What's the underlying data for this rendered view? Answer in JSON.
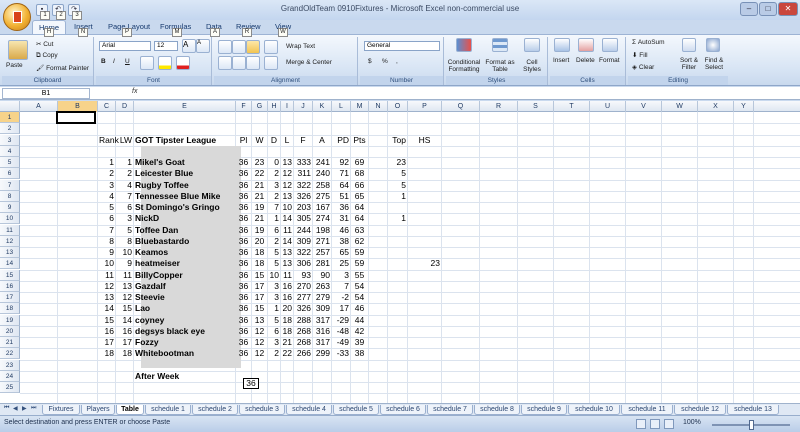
{
  "window": {
    "title": "GrandOldTeam 0910Fixtures - Microsoft Excel non-commercial use"
  },
  "qat": {
    "keytip1": "1",
    "keytip2": "2",
    "keytip3": "3"
  },
  "ribbon": {
    "tabs": [
      {
        "label": "Home",
        "key": "H"
      },
      {
        "label": "Insert",
        "key": "N"
      },
      {
        "label": "Page Layout",
        "key": "P"
      },
      {
        "label": "Formulas",
        "key": "M"
      },
      {
        "label": "Data",
        "key": "A"
      },
      {
        "label": "Review",
        "key": "R"
      },
      {
        "label": "View",
        "key": "W"
      }
    ],
    "clipboard": {
      "paste": "Paste",
      "cut": "Cut",
      "copy": "Copy",
      "format_painter": "Format Painter",
      "label": "Clipboard"
    },
    "font": {
      "name": "Arial",
      "size": "12",
      "bold": "B",
      "italic": "I",
      "underline": "U",
      "label": "Font",
      "grow": "A",
      "shrink": "A"
    },
    "alignment": {
      "wrap": "Wrap Text",
      "merge": "Merge & Center",
      "label": "Alignment"
    },
    "number": {
      "format": "General",
      "currency": "$",
      "percent": "%",
      "comma": ",",
      "label": "Number"
    },
    "styles": {
      "conditional": "Conditional Formatting",
      "format_table": "Format as Table",
      "cell_styles": "Cell Styles",
      "label": "Styles"
    },
    "cells": {
      "insert": "Insert",
      "delete": "Delete",
      "format": "Format",
      "label": "Cells"
    },
    "editing": {
      "autosum": "AutoSum",
      "fill": "Fill",
      "clear": "Clear",
      "sort": "Sort & Filter",
      "find": "Find & Select",
      "label": "Editing"
    }
  },
  "formula_bar": {
    "name_box": "B1",
    "fx": "fx",
    "value": ""
  },
  "columns": [
    "A",
    "B",
    "C",
    "D",
    "E",
    "F",
    "G",
    "H",
    "I",
    "J",
    "K",
    "L",
    "M",
    "N",
    "O",
    "P",
    "Q",
    "R",
    "S",
    "T",
    "U",
    "V",
    "W",
    "X",
    "Y"
  ],
  "rows": [
    "1",
    "2",
    "3",
    "4",
    "5",
    "6",
    "7",
    "8",
    "9",
    "10",
    "11",
    "12",
    "13",
    "14",
    "15",
    "16",
    "17",
    "18",
    "19",
    "20",
    "21",
    "22",
    "23",
    "24",
    "25"
  ],
  "table": {
    "headers": {
      "rank": "Rank",
      "lw": "LW",
      "title": "GOT Tipster League",
      "pl": "Pl",
      "w": "W",
      "d": "D",
      "l": "L",
      "f": "F",
      "a": "A",
      "pd": "PD",
      "pts": "Pts",
      "top": "Top",
      "hs": "HS"
    },
    "rows": [
      {
        "rank": "1",
        "lw": "1",
        "name": "Mikel's Goat",
        "pl": "36",
        "w": "23",
        "d": "0",
        "l": "13",
        "f": "333",
        "a": "241",
        "pd": "92",
        "pts": "69",
        "top": "23",
        "hs": ""
      },
      {
        "rank": "2",
        "lw": "2",
        "name": "Leicester Blue",
        "pl": "36",
        "w": "22",
        "d": "2",
        "l": "12",
        "f": "311",
        "a": "240",
        "pd": "71",
        "pts": "68",
        "top": "5",
        "hs": ""
      },
      {
        "rank": "3",
        "lw": "4",
        "name": "Rugby Toffee",
        "pl": "36",
        "w": "21",
        "d": "3",
        "l": "12",
        "f": "322",
        "a": "258",
        "pd": "64",
        "pts": "66",
        "top": "5",
        "hs": ""
      },
      {
        "rank": "4",
        "lw": "7",
        "name": "Tennessee Blue Mike",
        "pl": "36",
        "w": "21",
        "d": "2",
        "l": "13",
        "f": "326",
        "a": "275",
        "pd": "51",
        "pts": "65",
        "top": "1",
        "hs": ""
      },
      {
        "rank": "5",
        "lw": "6",
        "name": "St Domingo's Gringo",
        "pl": "36",
        "w": "19",
        "d": "7",
        "l": "10",
        "f": "203",
        "a": "167",
        "pd": "36",
        "pts": "64",
        "top": "",
        "hs": ""
      },
      {
        "rank": "6",
        "lw": "3",
        "name": "NickD",
        "pl": "36",
        "w": "21",
        "d": "1",
        "l": "14",
        "f": "305",
        "a": "274",
        "pd": "31",
        "pts": "64",
        "top": "1",
        "hs": ""
      },
      {
        "rank": "7",
        "lw": "5",
        "name": "Toffee Dan",
        "pl": "36",
        "w": "19",
        "d": "6",
        "l": "11",
        "f": "244",
        "a": "198",
        "pd": "46",
        "pts": "63",
        "top": "",
        "hs": ""
      },
      {
        "rank": "8",
        "lw": "8",
        "name": "Bluebastardo",
        "pl": "36",
        "w": "20",
        "d": "2",
        "l": "14",
        "f": "309",
        "a": "271",
        "pd": "38",
        "pts": "62",
        "top": "",
        "hs": ""
      },
      {
        "rank": "9",
        "lw": "10",
        "name": "Keamos",
        "pl": "36",
        "w": "18",
        "d": "5",
        "l": "13",
        "f": "322",
        "a": "257",
        "pd": "65",
        "pts": "59",
        "top": "",
        "hs": ""
      },
      {
        "rank": "10",
        "lw": "9",
        "name": "heatmeiser",
        "pl": "36",
        "w": "18",
        "d": "5",
        "l": "13",
        "f": "306",
        "a": "281",
        "pd": "25",
        "pts": "59",
        "top": "",
        "hs": "23"
      },
      {
        "rank": "11",
        "lw": "11",
        "name": "BillyCopper",
        "pl": "36",
        "w": "15",
        "d": "10",
        "l": "11",
        "f": "93",
        "a": "90",
        "pd": "3",
        "pts": "55",
        "top": "",
        "hs": ""
      },
      {
        "rank": "12",
        "lw": "13",
        "name": "Gazdalf",
        "pl": "36",
        "w": "17",
        "d": "3",
        "l": "16",
        "f": "270",
        "a": "263",
        "pd": "7",
        "pts": "54",
        "top": "",
        "hs": ""
      },
      {
        "rank": "13",
        "lw": "12",
        "name": "Steevie",
        "pl": "36",
        "w": "17",
        "d": "3",
        "l": "16",
        "f": "277",
        "a": "279",
        "pd": "-2",
        "pts": "54",
        "top": "",
        "hs": ""
      },
      {
        "rank": "14",
        "lw": "15",
        "name": "Lao",
        "pl": "36",
        "w": "15",
        "d": "1",
        "l": "20",
        "f": "326",
        "a": "309",
        "pd": "17",
        "pts": "46",
        "top": "",
        "hs": ""
      },
      {
        "rank": "15",
        "lw": "14",
        "name": "coyney",
        "pl": "36",
        "w": "13",
        "d": "5",
        "l": "18",
        "f": "288",
        "a": "317",
        "pd": "-29",
        "pts": "44",
        "top": "",
        "hs": ""
      },
      {
        "rank": "16",
        "lw": "16",
        "name": "degsys black eye",
        "pl": "36",
        "w": "12",
        "d": "6",
        "l": "18",
        "f": "268",
        "a": "316",
        "pd": "-48",
        "pts": "42",
        "top": "",
        "hs": ""
      },
      {
        "rank": "17",
        "lw": "17",
        "name": "Fozzy",
        "pl": "36",
        "w": "12",
        "d": "3",
        "l": "21",
        "f": "268",
        "a": "317",
        "pd": "-49",
        "pts": "39",
        "top": "",
        "hs": ""
      },
      {
        "rank": "18",
        "lw": "18",
        "name": "Whitebootman",
        "pl": "36",
        "w": "12",
        "d": "2",
        "l": "22",
        "f": "266",
        "a": "299",
        "pd": "-33",
        "pts": "38",
        "top": "",
        "hs": ""
      }
    ],
    "after_week_label": "After Week",
    "after_week_value": "36"
  },
  "sheets": [
    "Fixtures",
    "Players",
    "Table",
    "schedule 1",
    "schedule 2",
    "schedule 3",
    "schedule 4",
    "schedule 5",
    "schedule 6",
    "schedule 7",
    "schedule 8",
    "schedule 9",
    "schedule 10",
    "schedule 11",
    "schedule 12",
    "schedule 13"
  ],
  "active_sheet": "Table",
  "status": {
    "text": "Select destination and press ENTER or choose Paste",
    "zoom": "100%"
  }
}
